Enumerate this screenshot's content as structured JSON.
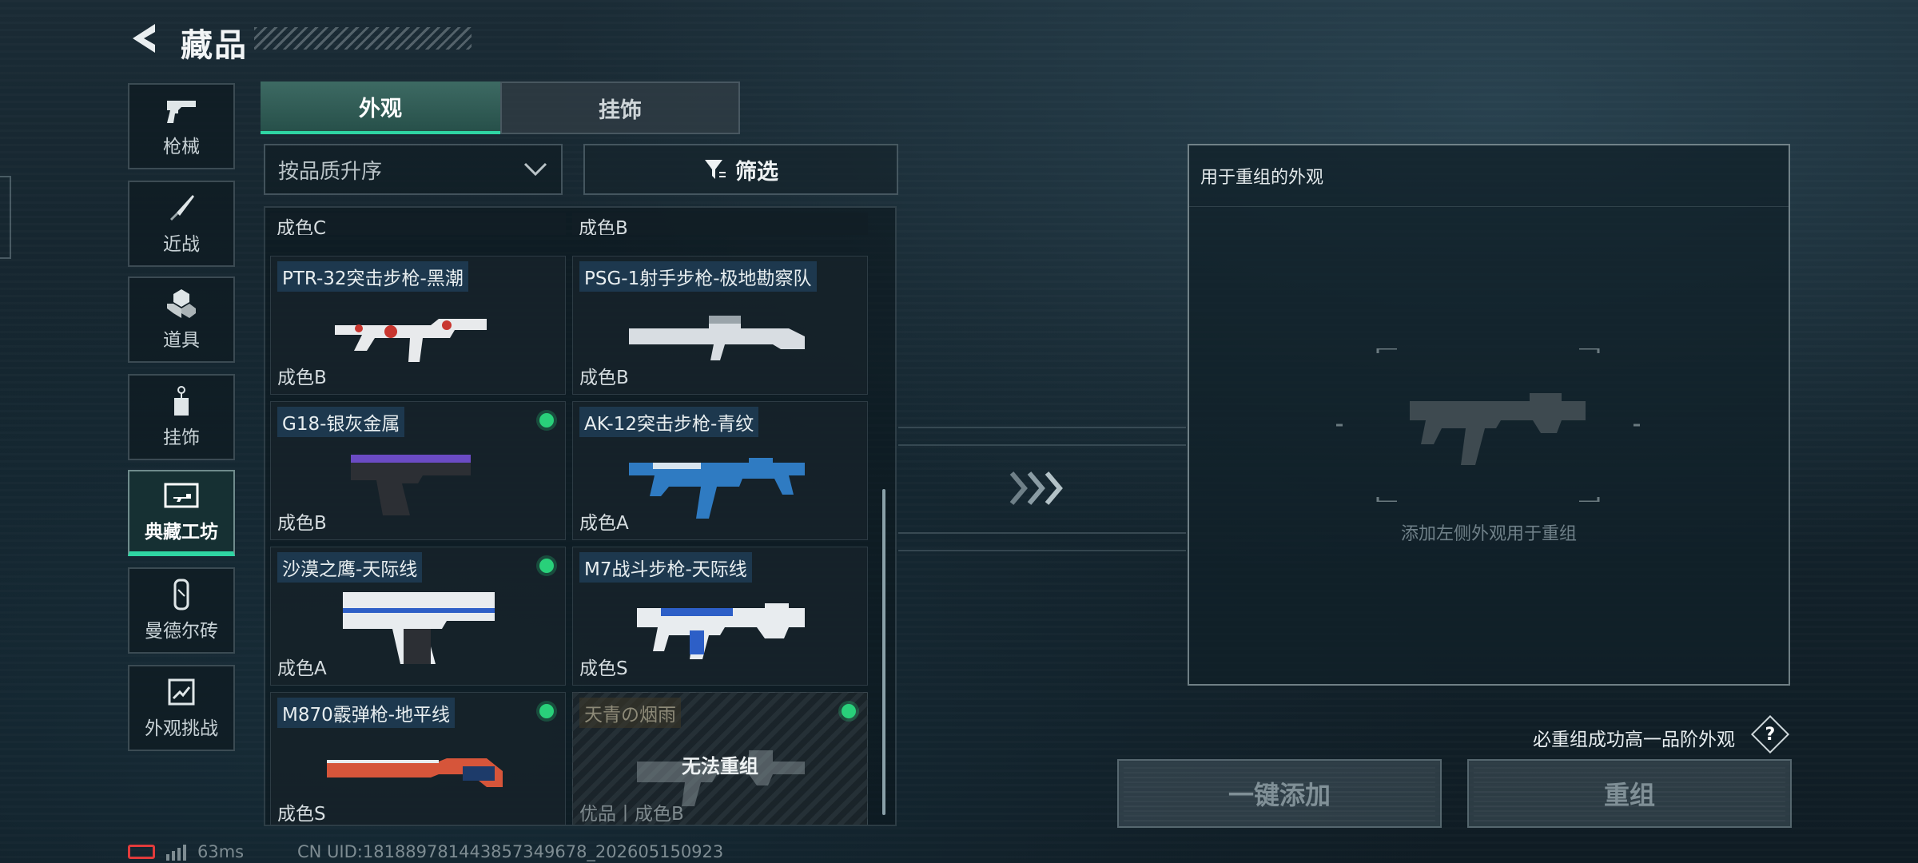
{
  "header": {
    "title": "藏品"
  },
  "sidebar": {
    "items": [
      {
        "label": "枪械",
        "icon": "pistol-icon",
        "active": false
      },
      {
        "label": "近战",
        "icon": "knife-icon",
        "active": false
      },
      {
        "label": "道具",
        "icon": "grenade-icon",
        "active": false
      },
      {
        "label": "挂饰",
        "icon": "charm-icon",
        "active": false
      },
      {
        "label": "典藏工坊",
        "icon": "workshop-icon",
        "active": true
      },
      {
        "label": "曼德尔砖",
        "icon": "brick-icon",
        "active": false
      },
      {
        "label": "外观挑战",
        "icon": "map-challenge-icon",
        "active": false
      }
    ]
  },
  "tabs": [
    {
      "label": "外观",
      "active": true
    },
    {
      "label": "挂饰",
      "active": false
    }
  ],
  "sort": {
    "label": "按品质升序"
  },
  "filter": {
    "label": "筛选"
  },
  "list": {
    "top_partial": [
      {
        "grade": "成色C"
      },
      {
        "grade": "成色B"
      }
    ],
    "cards": [
      {
        "name": "PTR-32突击步枪-黑潮",
        "grade": "成色B",
        "dot": false,
        "color": "#c8362f"
      },
      {
        "name": "PSG-1射手步枪-极地勘察队",
        "grade": "成色B",
        "dot": false,
        "color": "#d8dde2"
      },
      {
        "name": "G18-银灰金属",
        "grade": "成色B",
        "dot": true,
        "color": "#6b4bc4"
      },
      {
        "name": "AK-12突击步枪-青纹",
        "grade": "成色A",
        "dot": false,
        "color": "#2f7bc2"
      },
      {
        "name": "沙漠之鹰-天际线",
        "grade": "成色A",
        "dot": true,
        "color": "#e8ecef"
      },
      {
        "name": "M7战斗步枪-天际线",
        "grade": "成色S",
        "dot": false,
        "color": "#2d5fc7"
      },
      {
        "name": "M870霰弹枪-地平线",
        "grade": "成色S",
        "dot": true,
        "color": "#d6553a"
      },
      {
        "name": "天青の烟雨",
        "grade": "优品丨成色B",
        "dot": true,
        "disabled": true,
        "overlay": "无法重组",
        "color": "#8a969a"
      }
    ]
  },
  "panel": {
    "title": "用于重组的外观",
    "hint": "添加左侧外观用于重组"
  },
  "guarantee": {
    "text": "必重组成功高一品阶外观",
    "help": "?"
  },
  "buttons": {
    "add": "一键添加",
    "reroll": "重组"
  },
  "status": {
    "ping": "63ms",
    "uid": "CN UID:181889781443857349678_202605150923"
  },
  "colors": {
    "accent": "#2fd5a3",
    "dot": "#29d07a",
    "battery": "#e23b3b"
  }
}
